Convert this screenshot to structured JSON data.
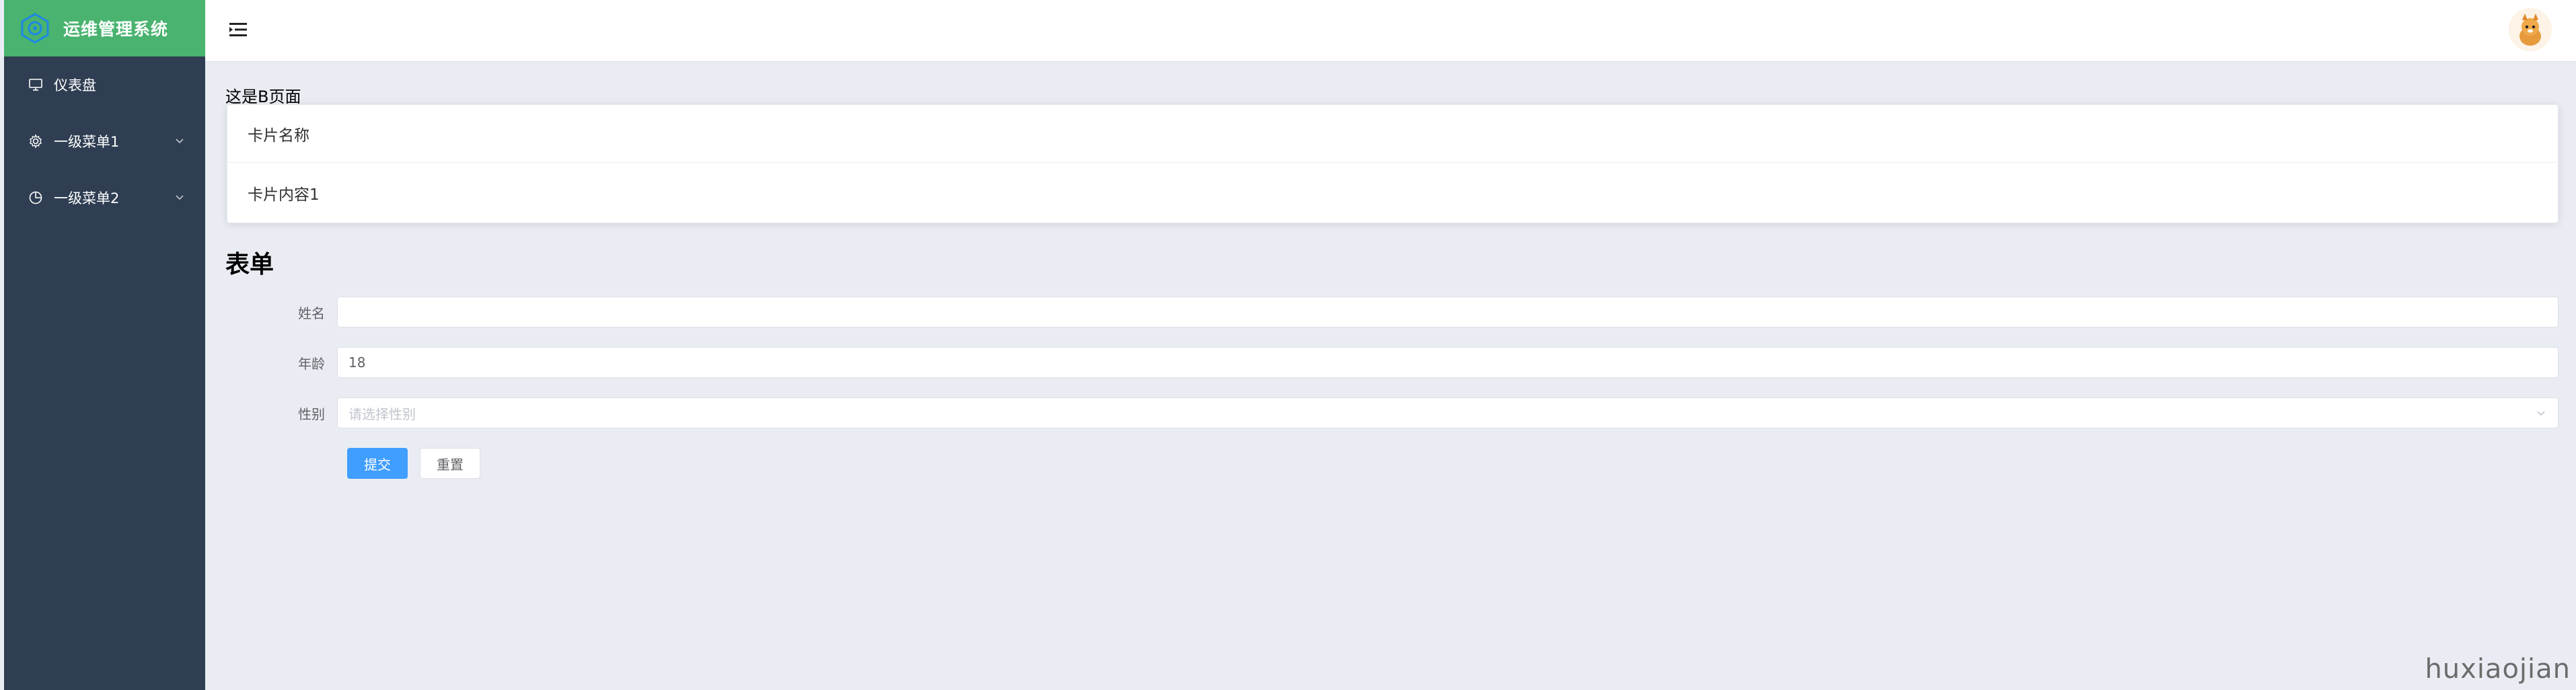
{
  "app": {
    "title": "运维管理系统"
  },
  "sidebar": {
    "items": [
      {
        "label": "仪表盘",
        "icon": "monitor-icon"
      },
      {
        "label": "一级菜单1",
        "icon": "gear-icon",
        "expandable": true
      },
      {
        "label": "一级菜单2",
        "icon": "pie-chart-icon",
        "expandable": true
      }
    ]
  },
  "main": {
    "page_text": "这是B页面",
    "card": {
      "header": "卡片名称",
      "content": "卡片内容1"
    },
    "form": {
      "title": "表单",
      "fields": [
        {
          "label": "姓名",
          "value": ""
        },
        {
          "label": "年龄",
          "value": "18"
        },
        {
          "label": "性别",
          "placeholder": "请选择性别"
        }
      ],
      "submit_label": "提交",
      "reset_label": "重置"
    }
  },
  "watermark": "huxiaojian",
  "colors": {
    "sidebar_bg": "#2f3e52",
    "logo_bg": "#49b36f",
    "primary": "#409eff",
    "page_bg": "#e9edf3"
  }
}
